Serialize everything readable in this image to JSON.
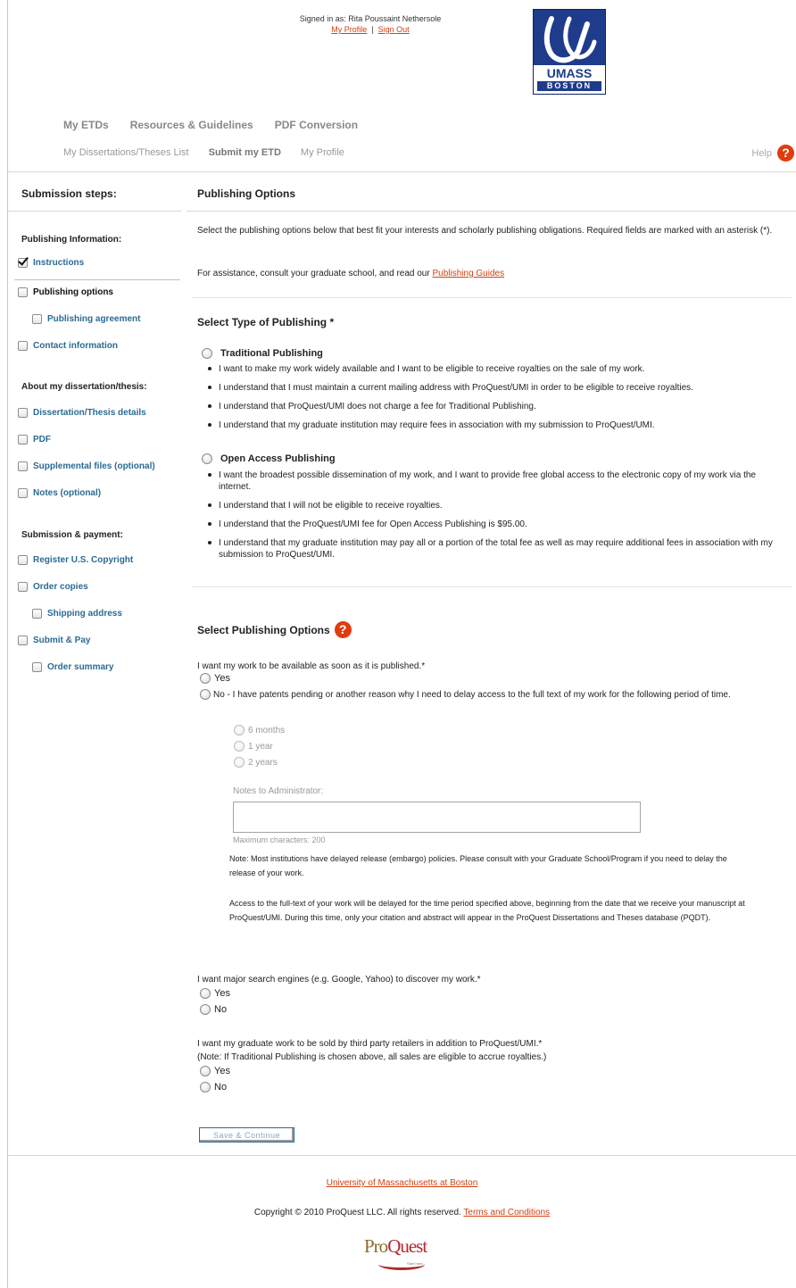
{
  "header": {
    "signed_in": "Signed in as: Rita Poussaint Nethersole",
    "my_profile": "My Profile",
    "sign_out": "Sign Out",
    "logo_line1": "UMASS",
    "logo_line2": "BOSTON"
  },
  "nav": {
    "primary": [
      "My ETDs",
      "Resources & Guidelines",
      "PDF Conversion"
    ],
    "secondary": [
      "My Dissertations/Theses List",
      "Submit my ETD",
      "My Profile"
    ],
    "help": "Help"
  },
  "sidebar": {
    "title": "Submission steps:",
    "group1": "Publishing Information:",
    "instructions": "Instructions",
    "publishing_options": "Publishing options",
    "publishing_agreement": "Publishing agreement",
    "contact_information": "Contact information",
    "group2": "About my dissertation/thesis:",
    "details": "Dissertation/Thesis details",
    "pdf": "PDF",
    "supplemental": "Supplemental files (optional)",
    "notes": "Notes (optional)",
    "group3": "Submission & payment:",
    "copyright": "Register U.S. Copyright",
    "order_copies": "Order copies",
    "shipping": "Shipping address",
    "submit_pay": "Submit & Pay",
    "order_summary": "Order summary"
  },
  "main": {
    "title": "Publishing Options",
    "intro": "Select the publishing options below that best fit your interests and scholarly publishing obligations. Required fields are marked with an asterisk (*).",
    "assist_prefix": "For assistance, consult your graduate school, and read our ",
    "assist_link": "Publishing Guides",
    "type_heading": "Select Type of Publishing *",
    "traditional": {
      "label": "Traditional Publishing",
      "bullets": [
        "I want to make my work widely available and I want to be eligible to receive royalties on the sale of my work.",
        "I understand that I must maintain a current mailing address with ProQuest/UMI in order to be eligible to receive royalties.",
        "I understand that ProQuest/UMI does not charge a fee for Traditional Publishing.",
        "I understand that my graduate institution may require fees in association with my submission to ProQuest/UMI."
      ]
    },
    "open_access": {
      "label": "Open Access Publishing",
      "bullets": [
        "I want the broadest possible dissemination of my work, and I want to provide free global access to the electronic copy of my work via the internet.",
        "I understand that I will not be eligible to receive royalties.",
        "I understand that the ProQuest/UMI fee for Open Access Publishing is $95.00.",
        "I understand that my graduate institution may pay all or a portion of the total fee as well as may require additional fees in association with my submission to ProQuest/UMI."
      ]
    },
    "options_heading": "Select Publishing Options",
    "avail_question": "I want my work to be available as soon as it is published.*",
    "yes": "Yes",
    "no_delay": "No - I have patents pending or another reason why I need to delay access to the full text of my work for the following period of time.",
    "periods": [
      "6 months",
      "1 year",
      "2 years"
    ],
    "notes_label": "Notes to Administrator:",
    "max_chars": "Maximum characters: 200",
    "note1": "Note: Most institutions have delayed release (embargo) policies. Please consult with your Graduate School/Program if you need to delay the release of your work.",
    "note2": "Access to the full-text of your work will be delayed for the time period specified above, beginning from the date that we receive your manuscript at ProQuest/UMI. During this time, only your citation and abstract will appear in the ProQuest Dissertations and Theses database (PQDT).",
    "search_question": "I want major search engines (e.g. Google, Yahoo) to discover my work.*",
    "retail_question": "I want my graduate work to be sold by third party retailers in addition to ProQuest/UMI.*",
    "retail_note": "(Note: If Traditional Publishing is chosen above, all sales are eligible to accrue royalties.)",
    "no": "No",
    "save_button": "Save & Continue"
  },
  "footer": {
    "university": "University of Massachusetts at Boston",
    "copyright": "Copyright © 2010 ProQuest LLC. All rights reserved. ",
    "terms": "Terms and Conditions",
    "logo_a": "Pro",
    "logo_b": "Quest",
    "logo_tag": "Start here."
  }
}
